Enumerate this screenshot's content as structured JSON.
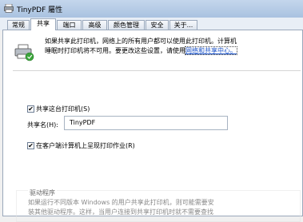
{
  "window": {
    "title": "TinyPDF 屬性"
  },
  "tabs": [
    "常规",
    "共享",
    "端口",
    "高级",
    "颜色管理",
    "安全",
    "关于..."
  ],
  "info": {
    "line1": "如果共享此打印机，网络上的所有用户都可以使用此打印机。计算机",
    "line2_prefix": "睡眠时打印机将不可用。要更改这些设置，请使用",
    "link": "网络和共享中心。"
  },
  "share_checkbox": {
    "label": "共享这台打印机(S)",
    "checked": true
  },
  "share_name": {
    "label": "共享名(H):",
    "value": "TinyPDF"
  },
  "render_checkbox": {
    "label": "在客户端计算机上呈现打印作业(R)",
    "checked": true
  },
  "driver": {
    "title": "驱动程序",
    "line1": "如果运行不同版本 Windows 的用户共享此打印机，则可能需要安",
    "line2": "装其他驱动程序。这样，当用户连接到共享打印机时就不需要查找"
  }
}
